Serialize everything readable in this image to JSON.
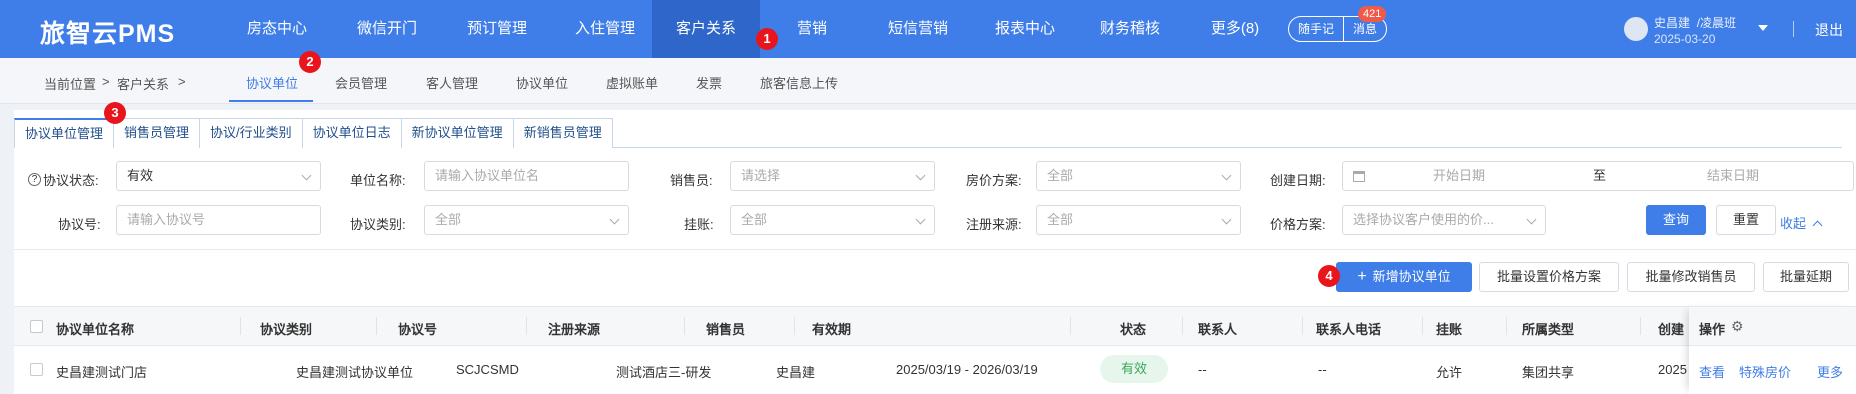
{
  "app": {
    "logo": "旅智云PMS"
  },
  "nav": [
    {
      "label": "房态中心"
    },
    {
      "label": "微信开门"
    },
    {
      "label": "预订管理"
    },
    {
      "label": "入住管理"
    },
    {
      "label": "客户关系",
      "active": true
    },
    {
      "label": "营销"
    },
    {
      "label": "短信营销"
    },
    {
      "label": "报表中心"
    },
    {
      "label": "财务稽核"
    },
    {
      "label": "更多(8)"
    }
  ],
  "quick": {
    "notes": "随手记",
    "messages": "消息",
    "message_count": "421"
  },
  "user": {
    "name": "史昌建",
    "shift": "/凌晨班",
    "date": "2025-03-20",
    "logout": "退出"
  },
  "markers": [
    "1",
    "2",
    "3",
    "4"
  ],
  "breadcrumb": {
    "prefix": "当前位置",
    "sep": ">",
    "section": "客户关系"
  },
  "subnav": [
    "协议单位",
    "会员管理",
    "客人管理",
    "协议单位",
    "虚拟账单",
    "发票",
    "旅客信息上传"
  ],
  "tabs": [
    "协议单位管理",
    "销售员管理",
    "协议/行业类别",
    "协议单位日志",
    "新协议单位管理",
    "新销售员管理"
  ],
  "filters": {
    "status": {
      "label": "协议状态:",
      "value": "有效"
    },
    "unit_name": {
      "label": "单位名称:",
      "placeholder": "请输入协议单位名"
    },
    "salesperson": {
      "label": "销售员:",
      "placeholder": "请选择"
    },
    "room_rate": {
      "label": "房价方案:",
      "value": "全部"
    },
    "created": {
      "label": "创建日期:",
      "start": "开始日期",
      "to": "至",
      "end": "结束日期"
    },
    "agreement_no": {
      "label": "协议号:",
      "placeholder": "请输入协议号"
    },
    "agreement_type": {
      "label": "协议类别:",
      "value": "全部"
    },
    "credit": {
      "label": "挂账:",
      "value": "全部"
    },
    "reg_source": {
      "label": "注册来源:",
      "value": "全部"
    },
    "price_plan": {
      "label": "价格方案:",
      "placeholder": "选择协议客户使用的价..."
    },
    "query": "查询",
    "reset": "重置",
    "collapse": "收起"
  },
  "actions": {
    "add": "新增协议单位",
    "batch_price": "批量设置价格方案",
    "batch_sales": "批量修改销售员",
    "batch_extend": "批量延期"
  },
  "table": {
    "headers": [
      "协议单位名称",
      "协议类别",
      "协议号",
      "注册来源",
      "销售员",
      "有效期",
      "状态",
      "联系人",
      "联系人电话",
      "挂账",
      "所属类型",
      "创建",
      "操作"
    ],
    "rows": [
      {
        "name": "史昌建测试门店",
        "type": "史昌建测试协议单位",
        "no": "SCJCSMD",
        "source": "测试酒店三-研发",
        "sales": "史昌建",
        "period": "2025/03/19 - 2026/03/19",
        "status": "有效",
        "contact": "--",
        "phone": "--",
        "credit": "允许",
        "belong": "集团共享",
        "created": "2025",
        "ops": [
          "查看",
          "特殊房价",
          "更多"
        ]
      }
    ]
  },
  "colors": {
    "primary": "#3f7de8",
    "nav_active": "#2f66c9",
    "marker": "#e8161c",
    "badge": "#f05a4a",
    "success": "#39a85a"
  }
}
